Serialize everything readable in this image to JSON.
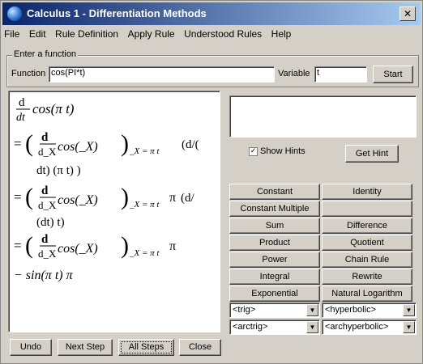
{
  "window": {
    "title": "Calculus 1 - Differentiation Methods",
    "close_label": "✕"
  },
  "menu": [
    "File",
    "Edit",
    "Rule Definition",
    "Apply Rule",
    "Understood Rules",
    "Help"
  ],
  "function_group": {
    "title": "Enter a function",
    "function_label": "Function",
    "function_value": "cos(PI*t)",
    "variable_label": "Variable",
    "variable_value": "t",
    "start_label": "Start"
  },
  "hints": {
    "show_hints_label": "Show Hints",
    "show_hints_checked": true,
    "get_hint_label": "Get Hint"
  },
  "rules": [
    [
      "Constant",
      "Identity"
    ],
    [
      "Constant Multiple",
      ""
    ],
    [
      "Sum",
      "Difference"
    ],
    [
      "Product",
      "Quotient"
    ],
    [
      "Power",
      "Chain Rule"
    ],
    [
      "Integral",
      "Rewrite"
    ],
    [
      "Exponential",
      "Natural Logarithm"
    ]
  ],
  "combos": [
    [
      "<trig>",
      "<hyperbolic>"
    ],
    [
      "<arctrig>",
      "<archyperbolic>"
    ]
  ],
  "bottom_buttons": [
    "Undo",
    "Next Step",
    "All Steps",
    "Close"
  ],
  "math": {
    "d": "d",
    "dt": "dt",
    "dX": "d_X",
    "cos_pi_t": "cos(π t)",
    "cos_X": "cos(_X)",
    "sub": "_X = π t",
    "eq": "=",
    "pi": "π",
    "dd": "(d/(",
    "dt_pi_t_close": "dt) (π t) )",
    "d_slash": "(d/",
    "dt_t": "(dt) t)",
    "final": "− sin(π t) π"
  }
}
